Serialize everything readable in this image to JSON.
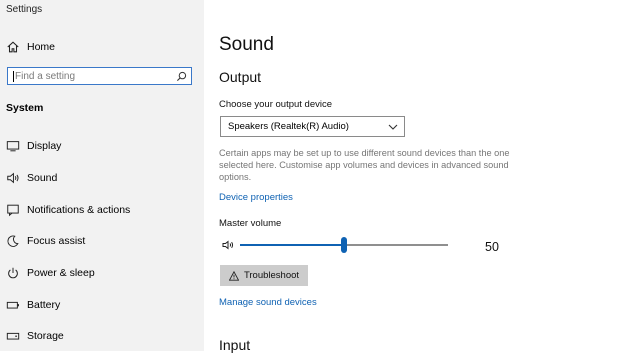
{
  "window": {
    "title": "Settings"
  },
  "sidebar": {
    "home_label": "Home",
    "search_placeholder": "Find a setting",
    "section_label": "System",
    "items": [
      {
        "label": "Display",
        "icon": "monitor-icon"
      },
      {
        "label": "Sound",
        "icon": "speaker-icon"
      },
      {
        "label": "Notifications & actions",
        "icon": "notification-icon"
      },
      {
        "label": "Focus assist",
        "icon": "moon-icon"
      },
      {
        "label": "Power & sleep",
        "icon": "power-icon"
      },
      {
        "label": "Battery",
        "icon": "battery-icon"
      },
      {
        "label": "Storage",
        "icon": "storage-icon"
      }
    ]
  },
  "main": {
    "title": "Sound",
    "output": {
      "heading": "Output",
      "device_label": "Choose your output device",
      "device_value": "Speakers (Realtek(R) Audio)",
      "description": "Certain apps may be set up to use different sound devices than the one selected here. Customise app volumes and devices in advanced sound options.",
      "device_properties_link": "Device properties",
      "master_volume_label": "Master volume",
      "master_volume_value": "50",
      "troubleshoot_label": "Troubleshoot",
      "manage_devices_link": "Manage sound devices"
    },
    "input": {
      "heading": "Input"
    }
  },
  "colors": {
    "accent": "#0f62b3",
    "sidebar_bg": "#f2f2f2",
    "button_bg": "#cccccc",
    "description_text": "#767676"
  }
}
